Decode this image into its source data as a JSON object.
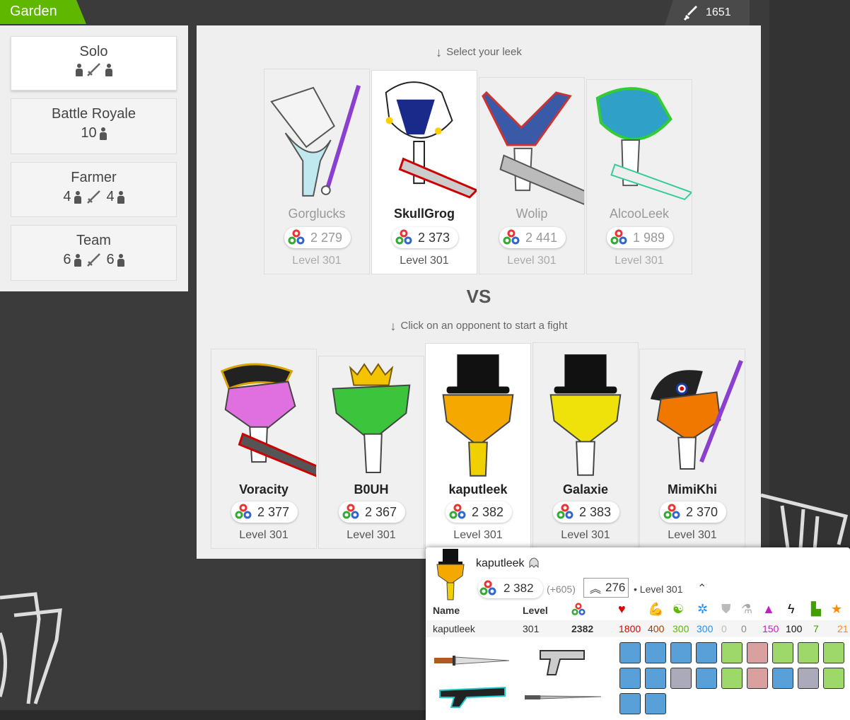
{
  "header": {
    "garden_label": "Garden",
    "talent_value": "1651"
  },
  "modes": [
    {
      "name": "Solo",
      "left_count": "",
      "right_count": ""
    },
    {
      "name": "Battle Royale",
      "count": "10"
    },
    {
      "name": "Farmer",
      "left_count": "4",
      "right_count": "4"
    },
    {
      "name": "Team",
      "left_count": "6",
      "right_count": "6"
    }
  ],
  "main": {
    "select_hint": "Select your leek",
    "vs_label": "VS",
    "fight_hint": "Click on an opponent to start a fight"
  },
  "my_leeks": [
    {
      "name": "Gorglucks",
      "talent": "2 279",
      "level": "Level 301"
    },
    {
      "name": "SkullGrog",
      "talent": "2 373",
      "level": "Level 301"
    },
    {
      "name": "Wolip",
      "talent": "2 441",
      "level": "Level 301"
    },
    {
      "name": "AlcooLeek",
      "talent": "1 989",
      "level": "Level 301"
    }
  ],
  "opponents": [
    {
      "name": "Voracity",
      "talent": "2 377",
      "level": "Level 301"
    },
    {
      "name": "B0UH",
      "talent": "2 367",
      "level": "Level 301"
    },
    {
      "name": "kaputleek",
      "talent": "2 382",
      "level": "Level 301"
    },
    {
      "name": "Galaxie",
      "talent": "2 383",
      "level": "Level 301"
    },
    {
      "name": "MimiKhi",
      "talent": "2 370",
      "level": "Level 301"
    }
  ],
  "popup": {
    "name": "kaputleek",
    "talent": "2 382",
    "delta": "(+605)",
    "rank": "276",
    "level": "• Level 301",
    "columns": {
      "name": "Name",
      "level": "Level"
    },
    "row": {
      "name": "kaputleek",
      "level": "301",
      "talent": "2382",
      "life": "1800",
      "strength": "400",
      "wisdom": "300",
      "agility": "300",
      "resistance": "0",
      "science": "0",
      "magic": "150",
      "frequency": "100",
      "mp": "7",
      "tp": "21"
    }
  },
  "colors": {
    "garden_green": "#5fb700",
    "life": "#e00000",
    "strength": "#a04000",
    "wisdom": "#5fb700",
    "agility": "#1e90ff",
    "resistance": "#bbbbbb",
    "science": "#888888",
    "magic": "#c020c0",
    "frequency": "#111111",
    "mp": "#3fa000",
    "tp": "#ff8c00"
  }
}
